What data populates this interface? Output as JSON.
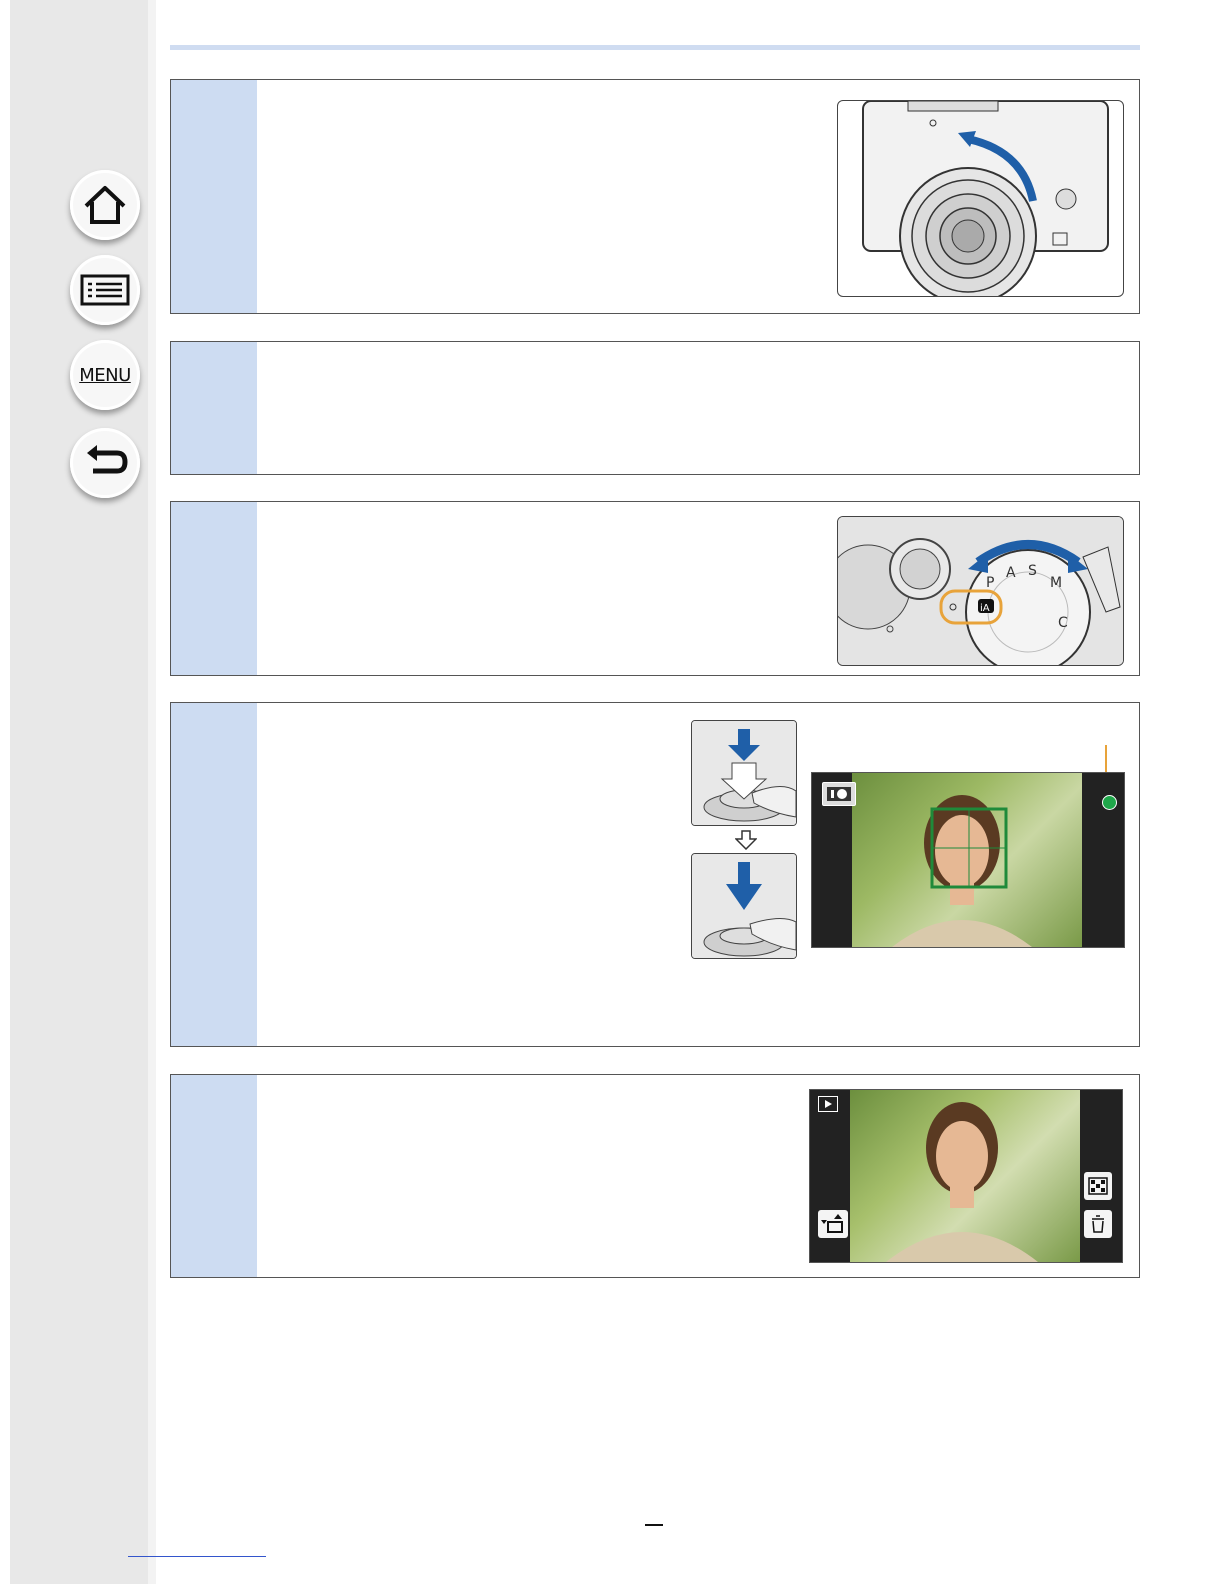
{
  "navigation": {
    "home_icon": "home-icon",
    "contents_icon": "list-icon",
    "menu_label": "MENU",
    "back_icon": "back-arrow-icon"
  },
  "steps": [
    {
      "illustration": "camera-lens-ring"
    },
    {
      "illustration": ""
    },
    {
      "illustration": "mode-dial"
    },
    {
      "illustration": "shutter-press"
    },
    {
      "illustration": "playback-screen"
    }
  ],
  "mode_dial": {
    "selected_mode": "iA",
    "letters": [
      "P",
      "A",
      "S",
      "M",
      "C"
    ]
  },
  "colors": {
    "step_number_column": "#cddcf2",
    "top_rule": "#cfdcf1",
    "dial_highlight": "#e8a33a",
    "arrow_blue": "#1f5fa8",
    "focus_frame": "#1f8a3a",
    "focus_indicator": "#1fa64a"
  }
}
